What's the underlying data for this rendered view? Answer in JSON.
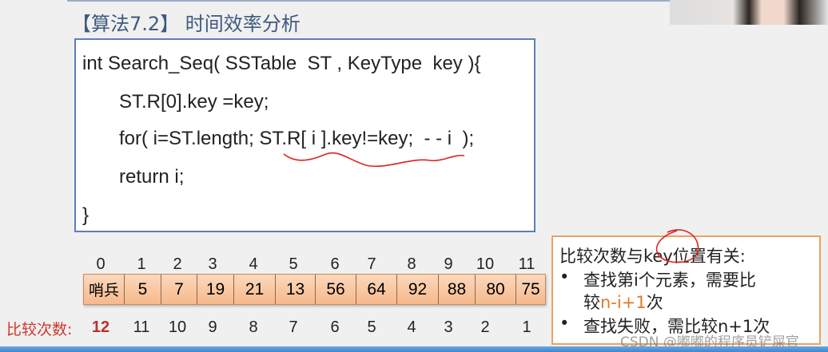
{
  "title": "【算法7.2】 时间效率分析",
  "code": [
    "int Search_Seq( SSTable  ST , KeyType  key ){",
    "ST.R[0].key =key;",
    "for( i=ST.length; ST.R[ i ].key!=key;  - - i  );",
    "return i;",
    "}"
  ],
  "indices": [
    "0",
    "1",
    "2",
    "3",
    "4",
    "5",
    "6",
    "7",
    "8",
    "9",
    "10",
    "11"
  ],
  "array": [
    "哨兵",
    "5",
    "7",
    "19",
    "21",
    "13",
    "56",
    "64",
    "92",
    "88",
    "80",
    "75"
  ],
  "count_label": "比较次数:",
  "counts": [
    "12",
    "11",
    "10",
    "9",
    "8",
    "7",
    "6",
    "5",
    "4",
    "3",
    "2",
    "1"
  ],
  "note": {
    "line1": "比较次数与key位置有关:",
    "b1a": "查找第i个元素，需要比",
    "b1b_pre": "较",
    "b1b_hl": "n-i+1",
    "b1b_post": "次",
    "b2": "查找失败，需比较n+1次"
  },
  "watermark": "CSDN @嘟嘟的程序员铲屎官"
}
